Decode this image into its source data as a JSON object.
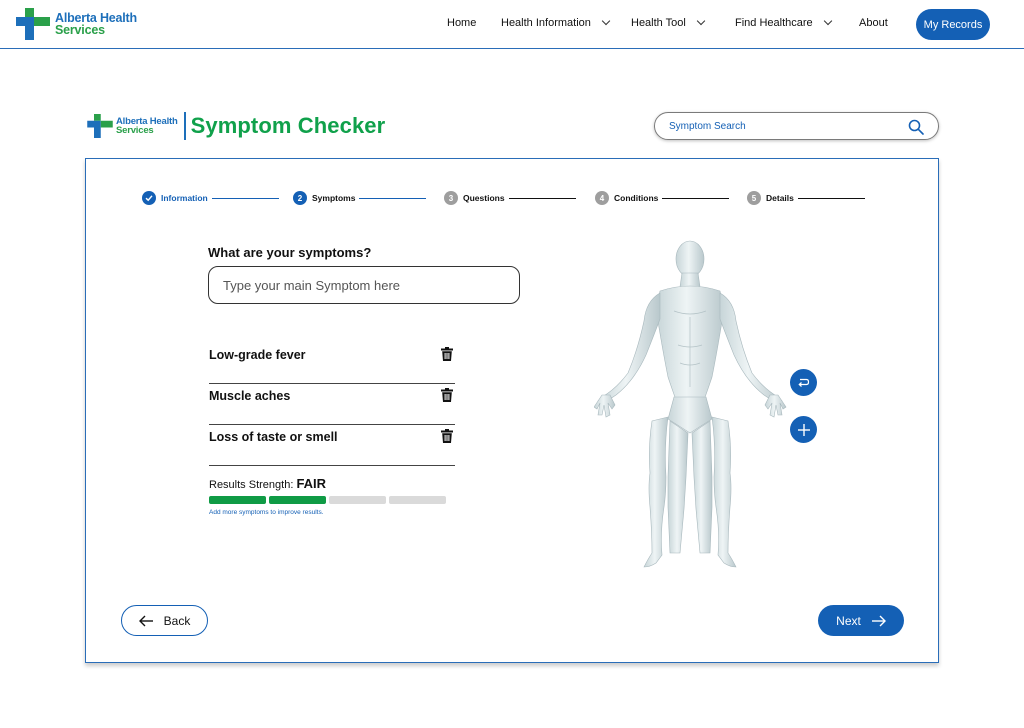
{
  "brand": {
    "line1": "Alberta Health",
    "line2": "Services"
  },
  "nav": {
    "home": "Home",
    "health_information": "Health Information",
    "health_tool": "Health Tool",
    "find_healthcare": "Find Healthcare",
    "about": "About",
    "my_records": "My Records"
  },
  "header": {
    "title": "Symptom Checker",
    "search_placeholder": "Symptom Search"
  },
  "stepper": [
    {
      "num": "",
      "label": "Information",
      "state": "done"
    },
    {
      "num": "2",
      "label": "Symptoms",
      "state": "current"
    },
    {
      "num": "3",
      "label": "Questions",
      "state": "todo"
    },
    {
      "num": "4",
      "label": "Conditions",
      "state": "todo"
    },
    {
      "num": "5",
      "label": "Details",
      "state": "todo"
    }
  ],
  "form": {
    "question": "What are your symptoms?",
    "input_placeholder": "Type your main Symptom here",
    "symptoms": [
      "Low-grade fever",
      "Muscle aches",
      "Loss of taste or smell"
    ],
    "strength_label": "Results Strength:",
    "strength_value": "FAIR",
    "strength_level": 2,
    "strength_total": 4,
    "hint": "Add more symptoms to improve results."
  },
  "buttons": {
    "back": "Back",
    "next": "Next"
  },
  "colors": {
    "primary": "#1460b5",
    "brand_green": "#10a14b",
    "strength_green": "#0f9b45"
  }
}
